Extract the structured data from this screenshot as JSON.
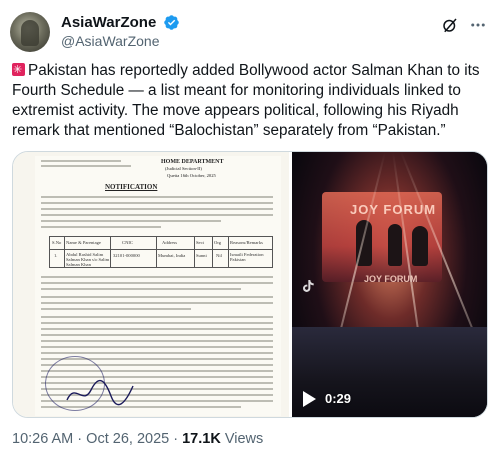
{
  "author": {
    "display_name": "AsiaWarZone",
    "handle": "@AsiaWarZone",
    "verified": true,
    "verified_color": "#1d9bf0"
  },
  "header_icons": [
    "grok-icon",
    "more-icon"
  ],
  "tweet": {
    "flag_icon": "flag-emoji-icon",
    "text": "Pakistan has reportedly added Bollywood actor Salman Khan to its Fourth Schedule — a list meant for monitoring individuals linked to extremist activity. The move appears political, following his Riyadh remark that mentioned “Balochistan” separately from “Pakistan.”"
  },
  "media": {
    "document": {
      "issuer": "HOME DEPARTMENT",
      "subtitle": "(Judicial Section-II)",
      "date_line": "Quetta 16th October, 2025",
      "heading": "NOTIFICATION",
      "table_headers": [
        "S.No",
        "Name & Parentage",
        "CNIC",
        "Address",
        "Sect",
        "Org",
        "Reasons/Remarks"
      ],
      "table_row": [
        "1.",
        "Abdul Rashid Salim Salman Khan s/o Salim Salman Khan",
        "32101-000000",
        "Mumbai, India",
        "Sunni",
        "Nil",
        "Ismaili Federation Pakistan"
      ]
    },
    "video": {
      "banner_text": "JOY FORUM",
      "banner_text_2": "JOY FORUM",
      "duration": "0:29",
      "watermark_icon": "tiktok-icon",
      "play_icon": "play-icon"
    }
  },
  "footer": {
    "time": "10:26 AM",
    "separator": "·",
    "date": "Oct 26, 2025",
    "views_count": "17.1K",
    "views_label": "Views"
  }
}
